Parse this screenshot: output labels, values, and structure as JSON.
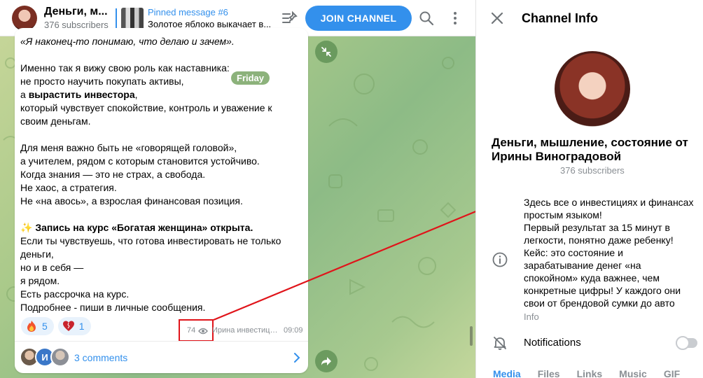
{
  "header": {
    "channel_name": "Деньги, м...",
    "subscribers": "376 subscribers",
    "pinned_title": "Pinned message #6",
    "pinned_text": "Золотое яблоко выкачает в...",
    "join_label": "JOIN CHANNEL"
  },
  "message": {
    "date_chip": "Friday",
    "lines": [
      "«Я наконец-то понимаю, что делаю и зачем».",
      "",
      "Именно так я вижу свою роль как наставника:",
      "не просто научить покупать активы,",
      "а вырастить инвестора,",
      "который чувствует спокойствие, контроль и уважение к своим деньгам.",
      "",
      "Для меня важно быть не «говорящей головой»,",
      "а учителем, рядом с которым становится устойчиво.",
      "Когда знания — это не страх, а свобода.",
      "Не хаос, а стратегия.",
      "Не «на авось», а взрослая финансовая позиция.",
      "",
      "✨ Запись на курс «Богатая женщина» открыта.",
      "Если ты чувствуешь, что готова инвестировать не только деньги,",
      "но и в себя —",
      "я рядом.",
      "Есть рассрочка на курс.",
      "Подробнее - пиши в личные сообщения."
    ],
    "reactions": [
      {
        "emoji": "fire",
        "count": "5"
      },
      {
        "emoji": "heart",
        "count": "1"
      }
    ],
    "views": "74",
    "author": "Ирина инвестици...",
    "time": "09:09",
    "comments_label": "3 comments",
    "comment_avatar_letter": "И"
  },
  "info": {
    "title": "Channel Info",
    "name": "Деньги, мышление, состояние от Ирины Виноградовой",
    "subscribers": "376 subscribers",
    "about": [
      "Здесь все о инвестициях и финансах простым языком!",
      "Первый результат за 15 минут в легкости, понятно даже ребенку!",
      "Кейс: это состояние и зарабатывание денег «на спокойном» куда важнее, чем конкретные цифры! У каждого они свои от брендовой сумки до авто"
    ],
    "about_label": "Info",
    "notifications_label": "Notifications",
    "tabs": [
      "Media",
      "Files",
      "Links",
      "Music",
      "GIF"
    ]
  },
  "colors": {
    "accent": "#3390ec",
    "annotation": "#e0141a"
  }
}
